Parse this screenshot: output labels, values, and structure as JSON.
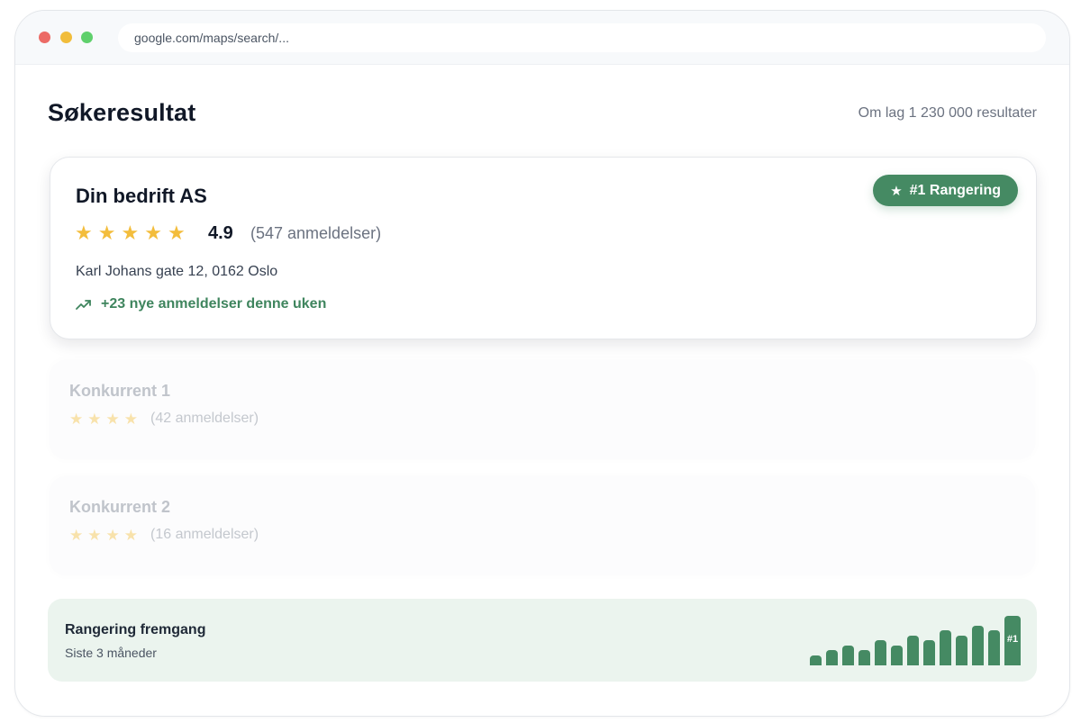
{
  "browser": {
    "url": "google.com/maps/search/..."
  },
  "header": {
    "title": "Søkeresultat",
    "results_count": "Om lag 1 230 000 resultater"
  },
  "main_result": {
    "name": "Din bedrift AS",
    "stars": 5,
    "rating": "4.9",
    "reviews": "(547 anmeldelser)",
    "address": "Karl Johans gate 12, 0162 Oslo",
    "trend": "+23 nye anmeldelser denne uken",
    "badge": "#1 Rangering",
    "accent_color": "#458a63",
    "star_color": "#f3bd3c"
  },
  "competitors": [
    {
      "name": "Konkurrent 1",
      "stars": 4,
      "reviews": "(42 anmeldelser)"
    },
    {
      "name": "Konkurrent 2",
      "stars": 4,
      "reviews": "(16 anmeldelser)"
    }
  ],
  "progress": {
    "title": "Rangering fremgang",
    "subtitle": "Siste 3 måneder",
    "top_label": "#1"
  },
  "chart_data": {
    "type": "bar",
    "values": [
      2,
      3,
      4,
      3,
      5,
      4,
      6,
      5,
      7,
      6,
      8,
      7,
      10
    ],
    "color": "#458a63",
    "annotations": [
      {
        "index": 12,
        "text": "#1"
      }
    ]
  }
}
